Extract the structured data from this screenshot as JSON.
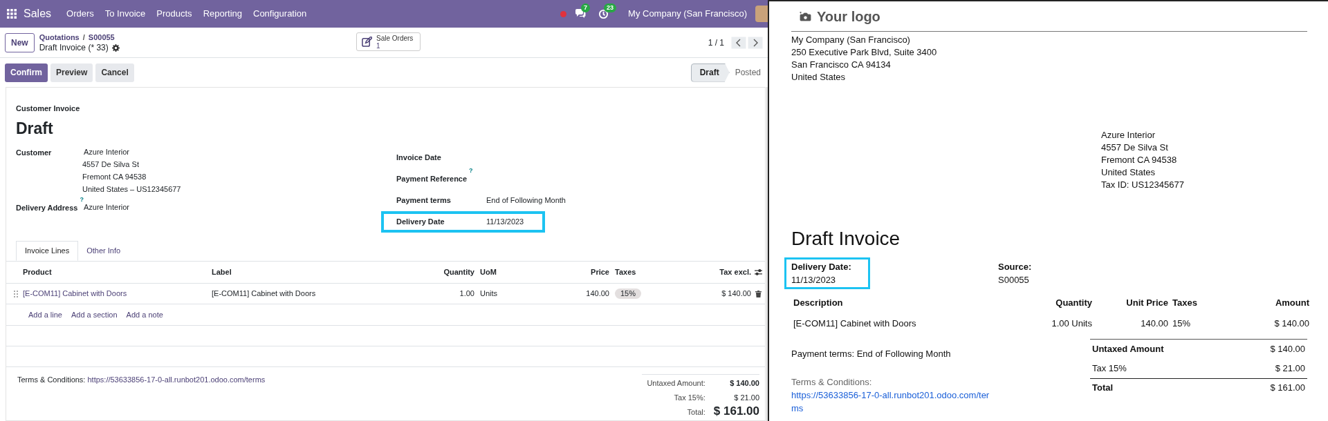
{
  "navbar": {
    "app": "Sales",
    "menu": [
      "Orders",
      "To Invoice",
      "Products",
      "Reporting",
      "Configuration"
    ],
    "messages_count": "7",
    "activities_count": "23",
    "company": "My Company (San Francisco)"
  },
  "control_panel": {
    "new_button": "New",
    "breadcrumb": [
      "Quotations",
      "S00055"
    ],
    "breadcrumb_separator": "/",
    "record_title": "Draft Invoice (* 33)",
    "smart_button": {
      "label": "Sale Orders",
      "count": "1"
    },
    "pager": "1 / 1"
  },
  "actions": [
    {
      "label": "Confirm",
      "kind": "primary"
    },
    {
      "label": "Preview",
      "kind": "secondary"
    },
    {
      "label": "Cancel",
      "kind": "secondary"
    }
  ],
  "statusbar": [
    {
      "label": "Draft",
      "selected": true
    },
    {
      "label": "Posted",
      "selected": false
    }
  ],
  "form": {
    "type": "Customer Invoice",
    "name": "Draft",
    "left_fields": [
      {
        "label": "Customer",
        "lines": [
          "Azure Interior",
          "4557 De Silva St",
          "Fremont CA 94538",
          "United States – US12345677"
        ]
      },
      {
        "label": "Delivery Address",
        "help": "?",
        "lines": [
          "Azure Interior"
        ]
      }
    ],
    "right_fields": [
      {
        "label": "Invoice Date",
        "highlighted": false
      },
      {
        "label": "Payment Reference",
        "help": "?",
        "highlighted": false
      },
      {
        "label": "Payment terms",
        "value": "End of Following Month",
        "highlighted": false
      },
      {
        "label": "Delivery Date",
        "value": "11/13/2023",
        "highlighted": true
      }
    ],
    "tabs": [
      {
        "label": "Invoice Lines",
        "selected": true
      },
      {
        "label": "Other Info",
        "selected": false
      }
    ],
    "lines": {
      "columns": [
        "Product",
        "Label",
        "Quantity",
        "UoM",
        "Price",
        "Taxes",
        "Tax excl."
      ],
      "rows": [
        {
          "product": "[E-COM11] Cabinet with Doors",
          "label": "[E-COM11] Cabinet with Doors",
          "quantity": "1.00",
          "uom": "Units",
          "price": "140.00",
          "taxes": "15%",
          "tax_excl": "$ 140.00"
        }
      ],
      "add_links": [
        "Add a line",
        "Add a section",
        "Add a note"
      ]
    },
    "terms": {
      "label": "Terms & Conditions:",
      "url": "https://53633856-17-0-all.runbot201.odoo.com/terms"
    },
    "totals": [
      {
        "label": "Untaxed Amount:",
        "value": "$ 140.00",
        "kind": "untaxed"
      },
      {
        "label": "Tax 15%:",
        "value": "$ 21.00",
        "kind": "tax"
      },
      {
        "label": "Total:",
        "value": "$ 161.00",
        "kind": "total"
      }
    ]
  },
  "report": {
    "logo": "Your logo",
    "company_lines": [
      "My Company (San Francisco)",
      "250 Executive Park Blvd, Suite 3400",
      "San Francisco CA 94134",
      "United States"
    ],
    "customer_lines": [
      "Azure Interior",
      "4557 De Silva St",
      "Fremont CA 94538",
      "United States",
      "Tax ID: US12345677"
    ],
    "title": "Draft Invoice",
    "info": [
      {
        "label": "Delivery Date:",
        "value": "11/13/2023",
        "highlighted": true
      },
      {
        "label": "Source:",
        "value": "S00055",
        "highlighted": false
      }
    ],
    "columns": [
      "Description",
      "Quantity",
      "Unit Price",
      "Taxes",
      "Amount"
    ],
    "rows": [
      {
        "description": "[E-COM11] Cabinet with Doors",
        "quantity": "1.00 Units",
        "unit_price": "140.00",
        "taxes": "15%",
        "amount": "$ 140.00"
      }
    ],
    "payment_terms": "Payment terms: End of Following Month",
    "terms": {
      "label": "Terms & Conditions:",
      "url": "https://53633856-17-0-all.runbot201.odoo.com/terms"
    },
    "totals": [
      {
        "label": "Untaxed Amount",
        "value": "$ 140.00",
        "kind": "untaxed"
      },
      {
        "label": "Tax 15%",
        "value": "$ 21.00",
        "kind": "tax"
      },
      {
        "label": "Total",
        "value": "$ 161.00",
        "kind": "total"
      }
    ]
  }
}
